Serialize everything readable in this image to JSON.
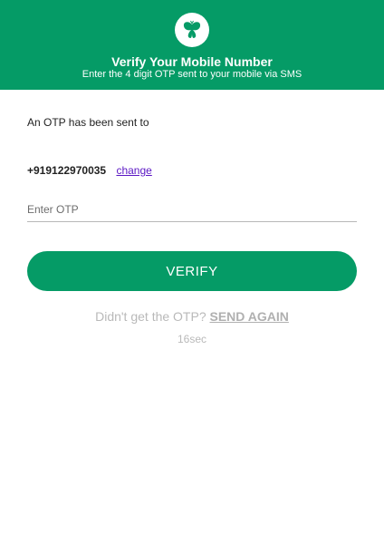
{
  "header": {
    "title": "Verify Your Mobile Number",
    "subtitle": "Enter the 4 digit OTP sent to your mobile via SMS",
    "logo_icon": "butterfly-icon",
    "background_color": "#059b66"
  },
  "body": {
    "sent_text": "An OTP has been sent to",
    "phone_number": "+919122970035",
    "change_label": "change"
  },
  "otp_input": {
    "placeholder": "Enter OTP",
    "value": ""
  },
  "verify_button": {
    "label": "VERIFY"
  },
  "resend": {
    "prompt": "Didn't get the OTP?",
    "link_label": "SEND AGAIN",
    "timer": "16sec"
  }
}
